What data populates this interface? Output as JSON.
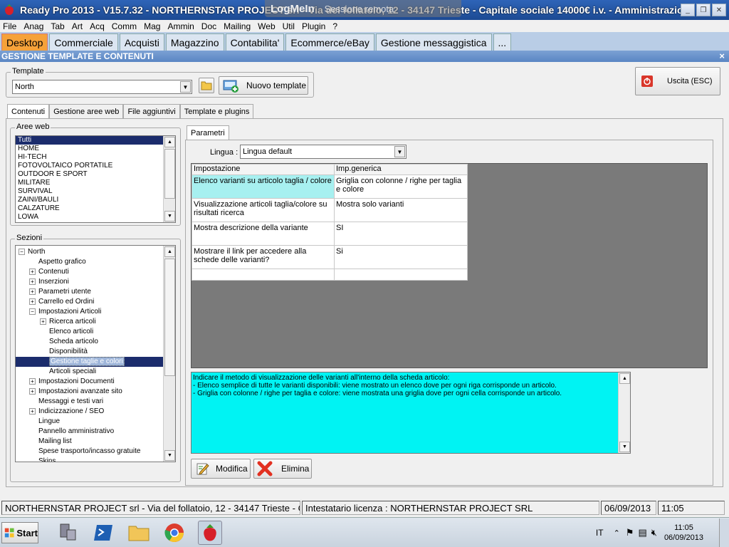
{
  "window": {
    "title": "Ready Pro 2013 - V15.7.32 - NORTHERNSTAR PROJECT srl - Via del follatoio, 12 - 34147 Trieste - Capitale sociale 14000€ i.v. - Amministrazione - TER...",
    "overlay_logo": "LogMeIn",
    "overlay_text": "Sessione remota",
    "btn_min": "_",
    "btn_max": "❐",
    "btn_close": "✕"
  },
  "menu": [
    "File",
    "Anag",
    "Tab",
    "Art",
    "Acq",
    "Comm",
    "Mag",
    "Ammin",
    "Doc",
    "Mailing",
    "Web",
    "Util",
    "Plugin",
    "?"
  ],
  "main_tabs": [
    "Desktop",
    "Commerciale",
    "Acquisti",
    "Magazzino",
    "Contabilita'",
    "Ecommerce/eBay",
    "Gestione messaggistica",
    "..."
  ],
  "section_header": "GESTIONE TEMPLATE E CONTENUTI",
  "section_close": "×",
  "template_group": {
    "label": "Template",
    "value": "North",
    "new_button": "Nuovo template"
  },
  "exit_button": "Uscita (ESC)",
  "sub_tabs": [
    "Contenuti",
    "Gestione aree web",
    "File aggiuntivi",
    "Template e plugins"
  ],
  "aree_web": {
    "label": "Aree web",
    "items": [
      "Tutti",
      "HOME",
      "HI-TECH",
      "FOTOVOLTAICO PORTATILE",
      "OUTDOOR E SPORT",
      "MILITARE",
      "SURVIVAL",
      "ZAINI/BAULI",
      "CALZATURE",
      "LOWA"
    ]
  },
  "sezioni": {
    "label": "Sezioni",
    "items": [
      {
        "label": "North",
        "exp": "−"
      },
      {
        "label": "Aspetto grafico",
        "exp": ""
      },
      {
        "label": "Contenuti",
        "exp": "+"
      },
      {
        "label": "Inserzioni",
        "exp": "+"
      },
      {
        "label": "Parametri utente",
        "exp": "+"
      },
      {
        "label": "Carrello ed Ordini",
        "exp": "+"
      },
      {
        "label": "Impostazioni Articoli",
        "exp": "−"
      },
      {
        "label": "Ricerca articoli",
        "exp": "+"
      },
      {
        "label": "Elenco articoli",
        "exp": ""
      },
      {
        "label": "Scheda articolo",
        "exp": ""
      },
      {
        "label": "Disponibilità",
        "exp": ""
      },
      {
        "label": "Gestione taglie e colori",
        "exp": ""
      },
      {
        "label": "Articoli speciali",
        "exp": ""
      },
      {
        "label": "Impostazioni Documenti",
        "exp": "+"
      },
      {
        "label": "Impostazioni avanzate sito",
        "exp": "+"
      },
      {
        "label": "Messaggi e testi vari",
        "exp": ""
      },
      {
        "label": "Indicizzazione / SEO",
        "exp": "+"
      },
      {
        "label": "Lingue",
        "exp": ""
      },
      {
        "label": "Pannello amministrativo",
        "exp": ""
      },
      {
        "label": "Mailing list",
        "exp": ""
      },
      {
        "label": "Spese trasporto/incasso gratuite",
        "exp": ""
      },
      {
        "label": "Skins",
        "exp": ""
      }
    ]
  },
  "parametri": {
    "tab": "Parametri",
    "lingua_label": "Lingua :",
    "lingua_value": "Lingua default",
    "col_impostazione": "Impostazione",
    "col_generica": "Imp.generica",
    "rows": [
      {
        "name": "Elenco varianti su articolo taglia / colore",
        "value": "Griglia con colonne / righe per taglia e colore"
      },
      {
        "name": "Visualizzazione articoli taglia/colore su risultati ricerca",
        "value": "Mostra solo varianti"
      },
      {
        "name": "Mostra descrizione della variante",
        "value": "SI"
      },
      {
        "name": "Mostrare il link per accedere alla schede delle varianti?",
        "value": "Si"
      },
      {
        "name": "",
        "value": ""
      }
    ],
    "description": [
      "Indicare il metodo di visualizzazione delle varianti all'interno della scheda articolo:",
      "- Elenco semplice di tutte le varianti disponibili: viene mostrato un elenco dove per ogni riga corrisponde un articolo.",
      "- Griglia con colonne / righe per taglia e colore: viene mostrata una griglia dove per ogni cella corrisponde un articolo."
    ],
    "modifica": "Modifica",
    "elimina": "Elimina"
  },
  "status": {
    "company": "NORTHERNSTAR PROJECT srl - Via del follatoio, 12 - 34147 Trieste - C",
    "license": "Intestatario licenza : NORTHERNSTAR PROJECT SRL",
    "date": "06/09/2013",
    "time": "11:05"
  },
  "taskbar": {
    "start": "Start",
    "lang": "IT",
    "clock_time": "11:05",
    "clock_date": "06/09/2013"
  },
  "colors": {
    "accent_tab": "#f6a23a",
    "description_bg": "#00f3f3",
    "highlight_cell": "#a7f0f0",
    "selected_row": "#1b2c6c"
  }
}
